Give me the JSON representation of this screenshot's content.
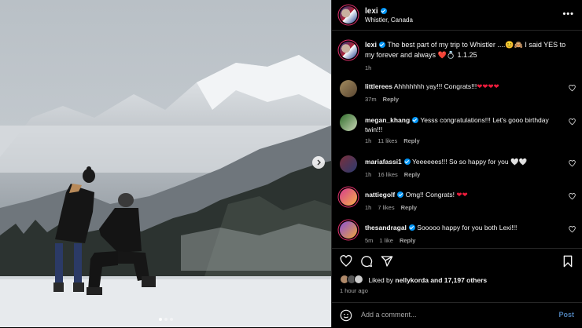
{
  "post": {
    "username": "lexi",
    "location": "Whistler, Canada",
    "caption": "The best part of my trip to Whistler ....😊🙈 I said YES to my forever and always ❤️💍 1.1.25",
    "caption_time": "1h",
    "likes_text": "Liked by",
    "liked_by_user": "nellykorda",
    "likes_rest": "and 17,197 others",
    "time_ago": "1 hour ago",
    "carousel_count": 3
  },
  "comments": [
    {
      "user": "littlerees",
      "verified": false,
      "text": "Ahhhhhhh yay!!! Congrats!!!",
      "emoji": "❤❤❤❤",
      "time": "37m",
      "likes": "",
      "reply": "Reply"
    },
    {
      "user": "megan_khang",
      "verified": true,
      "text": "Yesss congratulations!!! Let's gooo birthday twin!!!",
      "emoji": "",
      "time": "1h",
      "likes": "11 likes",
      "reply": "Reply"
    },
    {
      "user": "mariafassi1",
      "verified": true,
      "text": "Yeeeeees!!! So so happy for you",
      "emoji": "🤍🤍",
      "time": "1h",
      "likes": "16 likes",
      "reply": "Reply"
    },
    {
      "user": "nattiegolf",
      "verified": true,
      "text": "Omg!! Congrats!",
      "emoji": "❤❤",
      "time": "1h",
      "likes": "7 likes",
      "reply": "Reply"
    },
    {
      "user": "thesandragal",
      "verified": true,
      "text": "Sooooo happy for you both Lexi!!!",
      "emoji": "",
      "time": "5m",
      "likes": "1 like",
      "reply": "Reply"
    }
  ],
  "add_comment": {
    "placeholder": "Add a comment...",
    "post_label": "Post"
  },
  "icons": {
    "more": "•••",
    "next": "chevron-right",
    "like": "heart",
    "comment": "speech-bubble",
    "share": "paper-plane",
    "save": "bookmark",
    "emoji": "smiley"
  },
  "colors": {
    "accent": "#0095f6",
    "post_button": "#4d7fb4",
    "heart": "#ed1c3c"
  }
}
